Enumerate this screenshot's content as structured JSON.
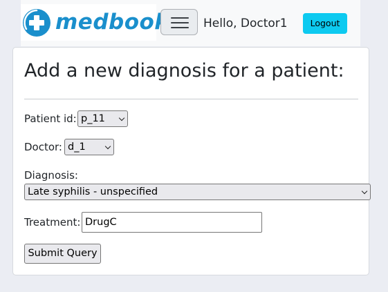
{
  "navbar": {
    "brand": "medbook",
    "greeting": "Hello, Doctor1",
    "logout_label": "Logout",
    "brand_color": "#1a8fcc",
    "logout_color": "#0dcaf0"
  },
  "form": {
    "title": "Add a new diagnosis for a patient:",
    "patient_label": "Patient id:",
    "patient_value": "p_11",
    "doctor_label": "Doctor:",
    "doctor_value": "d_1",
    "diagnosis_label": "Diagnosis:",
    "diagnosis_value": "Late syphilis - unspecified",
    "treatment_label": "Treatment:",
    "treatment_value": "DrugC",
    "submit_label": "Submit Query"
  }
}
